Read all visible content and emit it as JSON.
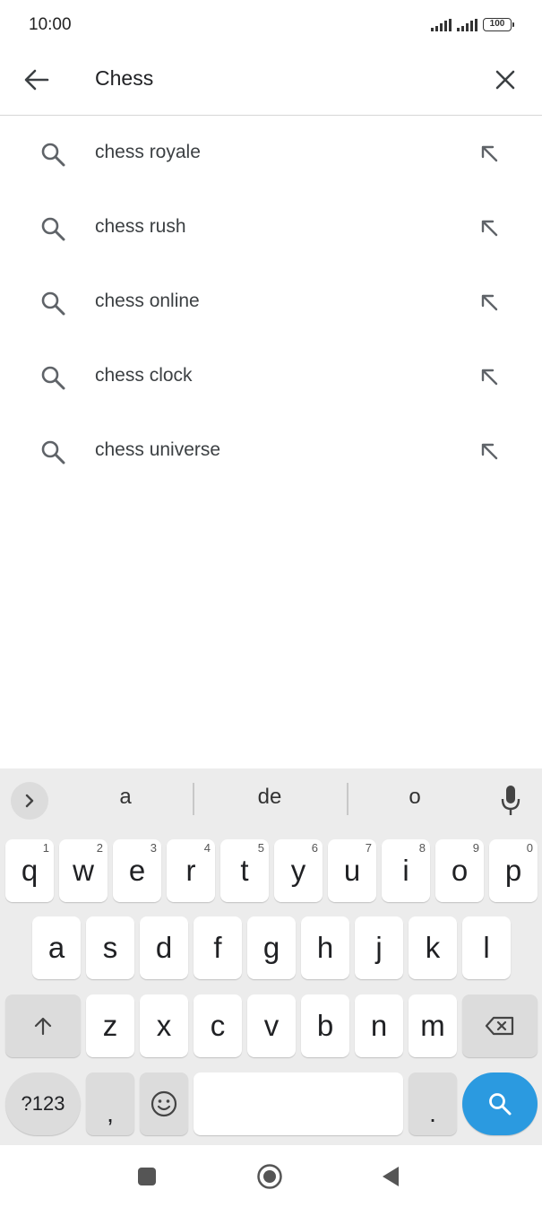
{
  "status_bar": {
    "time": "10:00",
    "battery": "100",
    "icons": [
      "signal-icon",
      "signal-icon",
      "battery-icon"
    ]
  },
  "search": {
    "query": "Chess",
    "back_icon": "arrow-left-icon",
    "clear_icon": "close-icon"
  },
  "suggestions": [
    {
      "text": "chess royale"
    },
    {
      "text": "chess rush"
    },
    {
      "text": "chess online"
    },
    {
      "text": "chess clock"
    },
    {
      "text": "chess universe"
    }
  ],
  "keyboard": {
    "toolbar": {
      "expand_icon": "chevron-right-icon",
      "word_suggestions": [
        "a",
        "de",
        "o"
      ],
      "mic_icon": "microphone-icon"
    },
    "row1": [
      {
        "label": "q",
        "hint": "1"
      },
      {
        "label": "w",
        "hint": "2"
      },
      {
        "label": "e",
        "hint": "3"
      },
      {
        "label": "r",
        "hint": "4"
      },
      {
        "label": "t",
        "hint": "5"
      },
      {
        "label": "y",
        "hint": "6"
      },
      {
        "label": "u",
        "hint": "7"
      },
      {
        "label": "i",
        "hint": "8"
      },
      {
        "label": "o",
        "hint": "9"
      },
      {
        "label": "p",
        "hint": "0"
      }
    ],
    "row2": [
      "a",
      "s",
      "d",
      "f",
      "g",
      "h",
      "j",
      "k",
      "l"
    ],
    "row3": [
      "z",
      "x",
      "c",
      "v",
      "b",
      "n",
      "m"
    ],
    "symbols_label": "?123",
    "comma_label": ",",
    "period_label": ".",
    "accent_color": "#2b9ae0"
  },
  "nav_bar": {
    "icons": [
      "recents-square-icon",
      "home-circle-icon",
      "back-triangle-icon"
    ]
  }
}
